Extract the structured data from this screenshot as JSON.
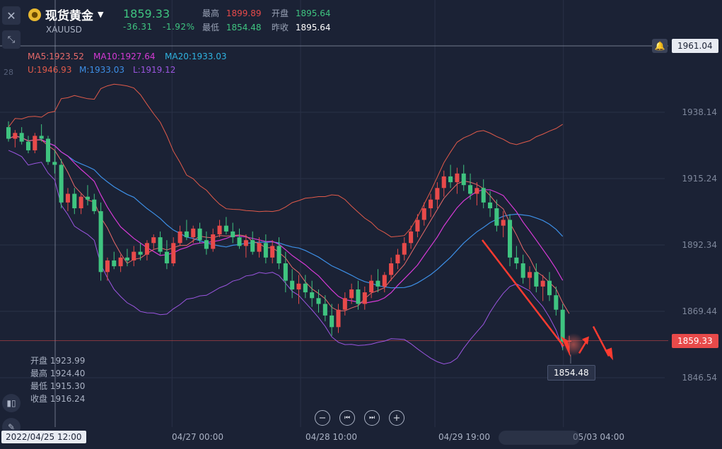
{
  "header": {
    "symbol_name": "现货黄金",
    "symbol_code": "XAUUSD",
    "price": "1859.33",
    "change": "-36.31",
    "change_pct": "-1.92%",
    "high_label": "最高",
    "high_value": "1899.89",
    "low_label": "最低",
    "low_value": "1854.48",
    "open_label": "开盘",
    "open_value": "1895.64",
    "prev_label": "昨收",
    "prev_value": "1895.64",
    "icons": {
      "close": "close-icon",
      "shrink": "collapse-icon",
      "coin": "gold-coin-icon",
      "dropdown": "caret-down-icon"
    }
  },
  "indicators": {
    "ma5": "MA5:1923.52",
    "ma10": "MA10:1927.64",
    "ma20": "MA20:1933.03",
    "upper": "U:1946.93",
    "mid": "M:1933.03",
    "lower": "L:1919.12",
    "partial_left": "28"
  },
  "ohlc_box": {
    "open": "开盘 1923.99",
    "high": "最高 1924.40",
    "low": "最低 1915.30",
    "close": "收盘 1916.24"
  },
  "right_tags": {
    "crosshair_price": "1961.04",
    "current_price": "1859.33",
    "low_marker": "1854.48"
  },
  "time_labels": {
    "selected": "2022/04/25 12:00",
    "t1": "04/27 00:00",
    "t2": "04/28 10:00",
    "t3": "04/29 19:00",
    "t4": "05/03 04:00"
  },
  "controls": [
    "zoom-out",
    "step-back",
    "step-forward",
    "zoom-in"
  ],
  "colors": {
    "up": "#e84a4a",
    "down": "#3fc480",
    "ma5": "#e86a6a",
    "ma10": "#d63ad6",
    "ma20": "#2fb3e0",
    "upper": "#e05a4a",
    "mid": "#3d8fe6",
    "lower": "#9b55e0",
    "annot": "#ff3b30"
  },
  "chart_data": {
    "type": "candlestick",
    "y_ticks": [
      1938.14,
      1915.24,
      1892.34,
      1869.44,
      1846.54
    ],
    "ylim": [
      1840,
      1965
    ],
    "x_count": 100,
    "x_tick_index": {
      "04/27 00:00": 28,
      "04/28 10:00": 50,
      "04/29 19:00": 73,
      "05/03 04:00": 95
    },
    "candles": [
      [
        1933,
        1935,
        1928,
        1929
      ],
      [
        1929,
        1932,
        1926,
        1931
      ],
      [
        1931,
        1933,
        1927,
        1928
      ],
      [
        1928,
        1930,
        1924,
        1925
      ],
      [
        1925,
        1931,
        1924,
        1930
      ],
      [
        1930,
        1934,
        1928,
        1929
      ],
      [
        1929,
        1930,
        1920,
        1921
      ],
      [
        1921,
        1925,
        1917,
        1920
      ],
      [
        1920,
        1922,
        1905,
        1907
      ],
      [
        1907,
        1912,
        1904,
        1910
      ],
      [
        1910,
        1912,
        1903,
        1905
      ],
      [
        1905,
        1910,
        1903,
        1909
      ],
      [
        1909,
        1913,
        1906,
        1908
      ],
      [
        1908,
        1910,
        1903,
        1904
      ],
      [
        1904,
        1907,
        1880,
        1883
      ],
      [
        1883,
        1888,
        1880,
        1887
      ],
      [
        1887,
        1890,
        1884,
        1885
      ],
      [
        1885,
        1889,
        1883,
        1888
      ],
      [
        1888,
        1891,
        1885,
        1887
      ],
      [
        1887,
        1892,
        1885,
        1890
      ],
      [
        1890,
        1893,
        1887,
        1889
      ],
      [
        1889,
        1894,
        1887,
        1893
      ],
      [
        1893,
        1896,
        1891,
        1895
      ],
      [
        1895,
        1897,
        1889,
        1890
      ],
      [
        1890,
        1894,
        1884,
        1886
      ],
      [
        1886,
        1895,
        1885,
        1893
      ],
      [
        1893,
        1899,
        1892,
        1897
      ],
      [
        1897,
        1901,
        1894,
        1895
      ],
      [
        1895,
        1899,
        1893,
        1898
      ],
      [
        1898,
        1900,
        1893,
        1894
      ],
      [
        1894,
        1897,
        1889,
        1891
      ],
      [
        1891,
        1898,
        1890,
        1896
      ],
      [
        1896,
        1901,
        1895,
        1899
      ],
      [
        1899,
        1902,
        1896,
        1897
      ],
      [
        1897,
        1900,
        1893,
        1895
      ],
      [
        1895,
        1898,
        1891,
        1892
      ],
      [
        1892,
        1896,
        1888,
        1894
      ],
      [
        1894,
        1897,
        1889,
        1890
      ],
      [
        1890,
        1895,
        1888,
        1893
      ],
      [
        1893,
        1896,
        1886,
        1888
      ],
      [
        1888,
        1894,
        1886,
        1892
      ],
      [
        1892,
        1895,
        1884,
        1886
      ],
      [
        1886,
        1890,
        1876,
        1880
      ],
      [
        1880,
        1884,
        1874,
        1877
      ],
      [
        1877,
        1882,
        1872,
        1879
      ],
      [
        1879,
        1882,
        1874,
        1876
      ],
      [
        1876,
        1880,
        1871,
        1874
      ],
      [
        1874,
        1877,
        1869,
        1872
      ],
      [
        1872,
        1875,
        1866,
        1868
      ],
      [
        1868,
        1872,
        1861,
        1864
      ],
      [
        1864,
        1872,
        1862,
        1870
      ],
      [
        1870,
        1876,
        1868,
        1874
      ],
      [
        1874,
        1879,
        1872,
        1877
      ],
      [
        1877,
        1880,
        1870,
        1872
      ],
      [
        1872,
        1878,
        1870,
        1876
      ],
      [
        1876,
        1882,
        1874,
        1880
      ],
      [
        1880,
        1884,
        1876,
        1878
      ],
      [
        1878,
        1883,
        1876,
        1882
      ],
      [
        1882,
        1888,
        1880,
        1886
      ],
      [
        1886,
        1891,
        1884,
        1889
      ],
      [
        1889,
        1895,
        1887,
        1893
      ],
      [
        1893,
        1899,
        1891,
        1897
      ],
      [
        1897,
        1903,
        1895,
        1901
      ],
      [
        1901,
        1907,
        1899,
        1905
      ],
      [
        1905,
        1910,
        1902,
        1908
      ],
      [
        1908,
        1914,
        1905,
        1912
      ],
      [
        1912,
        1918,
        1909,
        1916
      ],
      [
        1916,
        1920,
        1912,
        1914
      ],
      [
        1914,
        1919,
        1910,
        1917
      ],
      [
        1917,
        1920,
        1911,
        1913
      ],
      [
        1913,
        1917,
        1908,
        1910
      ],
      [
        1910,
        1914,
        1906,
        1912
      ],
      [
        1912,
        1915,
        1905,
        1907
      ],
      [
        1907,
        1911,
        1902,
        1905
      ],
      [
        1905,
        1908,
        1897,
        1899
      ],
      [
        1899,
        1904,
        1895,
        1901
      ],
      [
        1901,
        1903,
        1885,
        1888
      ],
      [
        1888,
        1892,
        1884,
        1886
      ],
      [
        1886,
        1889,
        1879,
        1881
      ],
      [
        1881,
        1885,
        1877,
        1883
      ],
      [
        1883,
        1886,
        1876,
        1878
      ],
      [
        1878,
        1882,
        1873,
        1880
      ],
      [
        1880,
        1883,
        1873,
        1875
      ],
      [
        1875,
        1878,
        1868,
        1870
      ],
      [
        1870,
        1872,
        1856,
        1859
      ],
      [
        1859,
        1861,
        1854.48,
        1859.33
      ]
    ]
  }
}
